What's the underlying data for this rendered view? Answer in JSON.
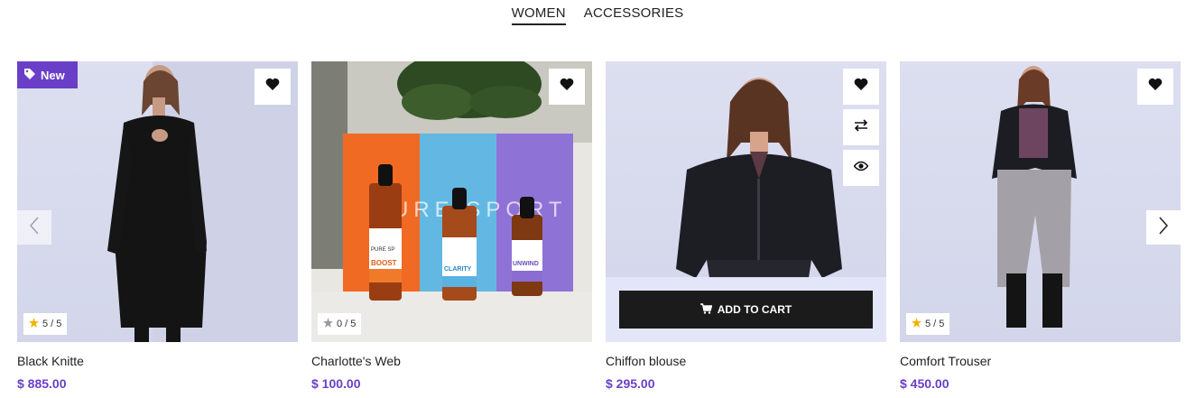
{
  "tabs": [
    {
      "label": "WOMEN",
      "active": true
    },
    {
      "label": "ACCESSORIES",
      "active": false
    }
  ],
  "products": [
    {
      "name": "Black Knitte",
      "price": "$ 885.00",
      "rating": "5 / 5",
      "badge": "New"
    },
    {
      "name": "Charlotte's Web",
      "price": "$ 100.00",
      "rating": "0 / 5"
    },
    {
      "name": "Chiffon blouse",
      "price": "$ 295.00",
      "cart_label": "ADD TO CART"
    },
    {
      "name": "Comfort Trouser",
      "price": "$ 450.00",
      "rating": "5 / 5"
    }
  ],
  "product_image_text": {
    "brand_letters": "PURE SPORT",
    "bottle_brand": "PURE SP",
    "bottle_labels": [
      "BOOST",
      "CLARITY",
      "UNWIND"
    ]
  },
  "colors": {
    "accent": "#6a3fc8",
    "star": "#f2b300",
    "star_empty": "#999999",
    "button_dark": "#1b1b1b"
  },
  "icons": [
    "tag-icon",
    "heart-icon",
    "compare-icon",
    "eye-icon",
    "star-icon",
    "cart-icon",
    "chevron-left-icon",
    "chevron-right-icon"
  ]
}
